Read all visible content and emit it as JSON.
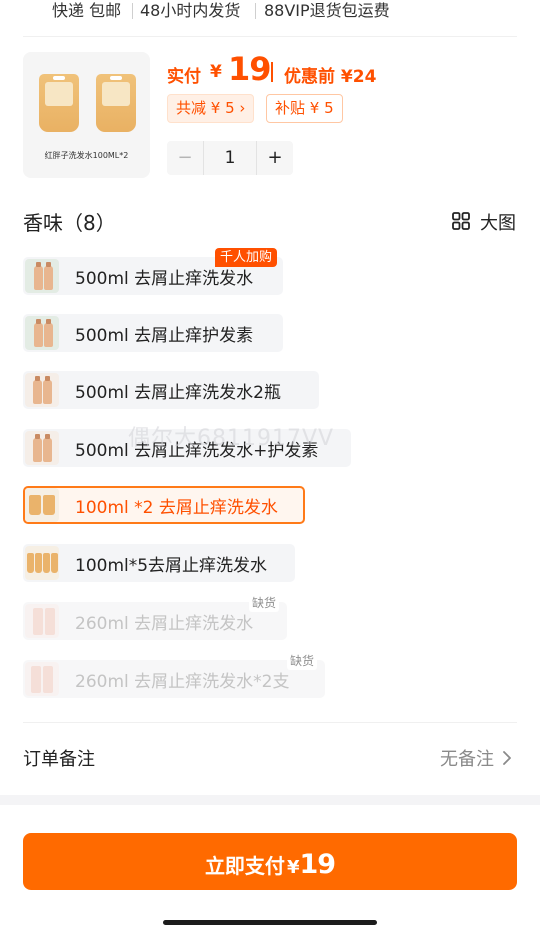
{
  "service_tags": [
    "快递 包邮",
    "48小时内发货",
    "88VIP退货包运费"
  ],
  "product": {
    "caption": "红胖子洗发水100ML*2",
    "pay_label": "实付",
    "currency": "¥",
    "pay_amount": "19",
    "before_label": "优惠前",
    "before_amount": "¥24",
    "reduce_chip": "共减 ¥ 5 ›",
    "subsidy_chip": "补贴 ¥ 5",
    "quantity": "1",
    "minus": "−",
    "plus": "+"
  },
  "section": {
    "title": "香味（8）",
    "bigview_label": "大图"
  },
  "options": [
    {
      "label": "500ml 去屑止痒洗发水",
      "state": "normal"
    },
    {
      "label": "500ml 去屑止痒护发素",
      "state": "normal"
    },
    {
      "label": "500ml  去屑止痒洗发水2瓶",
      "state": "normal"
    },
    {
      "label": "500ml 去屑止痒洗发水+护发素",
      "state": "normal"
    },
    {
      "label": "100ml *2 去屑止痒洗发水",
      "state": "selected"
    },
    {
      "label": "100ml*5去屑止痒洗发水",
      "state": "normal"
    },
    {
      "label": "260ml  去屑止痒洗发水",
      "state": "out_of_stock"
    },
    {
      "label": "260ml  去屑止痒洗发水*2支",
      "state": "out_of_stock"
    }
  ],
  "badges": {
    "hot": "千人加购",
    "out_of_stock": "缺货"
  },
  "watermark": "偶尔大6811917VV",
  "remark": {
    "label": "订单备注",
    "value": "无备注"
  },
  "pay_button": {
    "label": "立即支付",
    "currency": "¥",
    "amount": "19"
  },
  "colors": {
    "accent": "#ff5000",
    "button": "#ff6a00",
    "selected_border": "#ff7a18"
  }
}
